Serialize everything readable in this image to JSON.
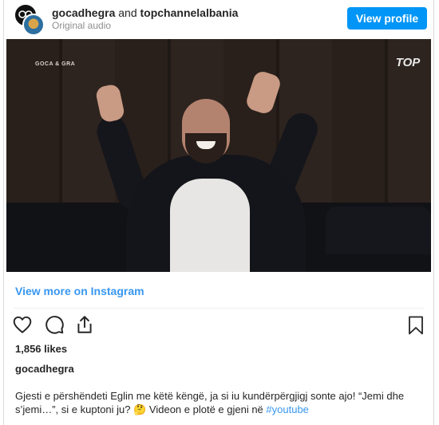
{
  "header": {
    "primary_account": "gocadhegra",
    "and_text": "and",
    "secondary_account": "topchannelalbania",
    "audio": "Original audio",
    "view_profile": "View profile"
  },
  "media": {
    "watermark_left": "GOCA & GRA",
    "watermark_right": "TOP"
  },
  "view_more": "View more on Instagram",
  "actions": {
    "icons": [
      "heart-icon",
      "comment-icon",
      "share-icon",
      "bookmark-icon"
    ]
  },
  "likes": "1,856 likes",
  "caption": {
    "username": "gocadhegra",
    "text": "Gjesti e përshëndeti Eglin me këtë këngë, ja si iu kundërpërgjigj sonte ajo! “Jemi dhe s’jemi…”, si e kuptoni ju? 🤔 Videon e plotë e gjeni në ",
    "hashtag": "#youtube"
  },
  "colors": {
    "accent": "#0095f6",
    "link": "#3897f0",
    "muted": "#8e8e8e"
  }
}
